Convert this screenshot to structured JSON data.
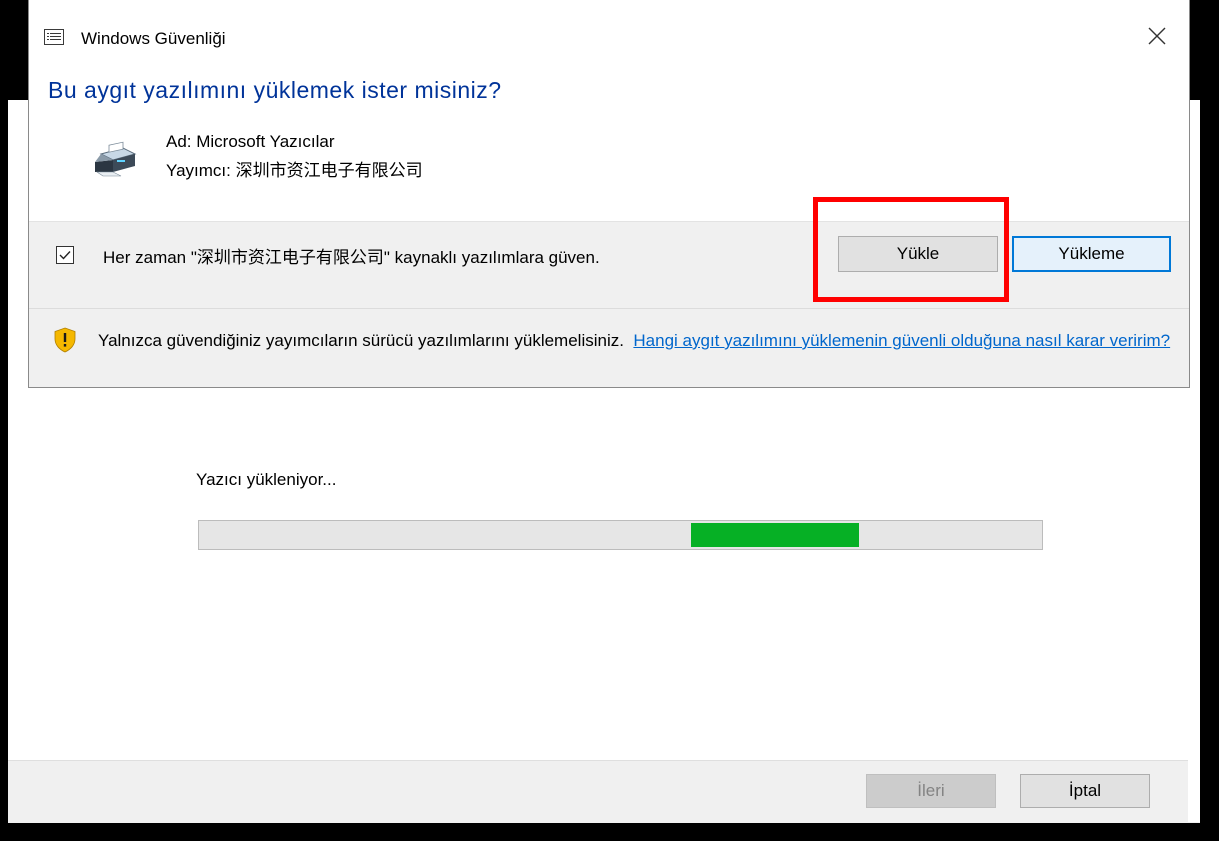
{
  "dialog": {
    "title": "Windows Güvenliği",
    "question": "Bu aygıt yazılımını yüklemek ister misiniz?",
    "name_line": "Ad: Microsoft Yazıcılar",
    "publisher_line": "Yayımcı: 深圳市资江电子有限公司",
    "trust_checkbox_checked": true,
    "trust_label": "Her zaman \"深圳市资江电子有限公司\" kaynaklı yazılımlara güven.",
    "install_button": "Yükle",
    "dont_install_button": "Yükleme",
    "warning_text": "Yalnızca güvendiğiniz yayımcıların sürücü yazılımlarını yüklemelisiniz.",
    "warning_link": "Hangi aygıt yazılımını yüklemenin güvenli olduğuna nasıl karar veririm?",
    "icons": [
      "window-menu-icon",
      "close-icon",
      "printer-icon",
      "warning-shield-icon",
      "checkmark-icon"
    ]
  },
  "wizard": {
    "status_text": "Yazıcı yükleniyor...",
    "progress_style": "marquee",
    "progress_color": "#06b025",
    "next_button": "İleri",
    "cancel_button": "İptal"
  },
  "colors": {
    "heading": "#003399",
    "link": "#0066cc",
    "default_button_border": "#0078d7",
    "annotation": "#ff0000"
  }
}
